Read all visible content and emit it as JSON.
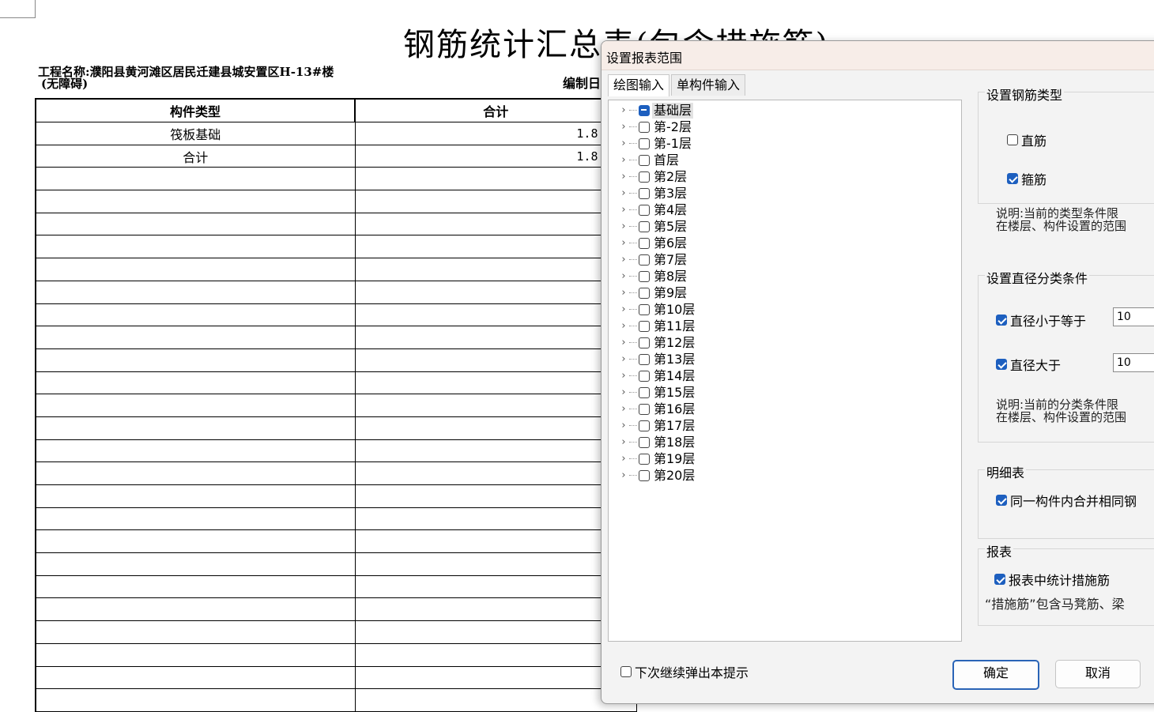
{
  "report": {
    "title": "钢筋统计汇总表(包含措施筋)",
    "project_label": "工程名称:濮阳县黄河滩区居民迁建县城安置区H-13#楼",
    "project_sub": "(无障碍)",
    "compiled_label": "编制日",
    "headers": [
      "构件类型",
      "合计"
    ],
    "rows": [
      {
        "type": "筏板基础",
        "total": "1.8"
      },
      {
        "type": "合计",
        "total": "1.8"
      }
    ]
  },
  "dialog": {
    "title": "设置报表范围",
    "tabs": [
      {
        "label": "绘图输入",
        "active": true
      },
      {
        "label": "单构件输入",
        "active": false
      }
    ],
    "floors": [
      {
        "label": "基础层",
        "state": "partial"
      },
      {
        "label": "第-2层",
        "state": "off"
      },
      {
        "label": "第-1层",
        "state": "off"
      },
      {
        "label": "首层",
        "state": "off"
      },
      {
        "label": "第2层",
        "state": "off"
      },
      {
        "label": "第3层",
        "state": "off"
      },
      {
        "label": "第4层",
        "state": "off"
      },
      {
        "label": "第5层",
        "state": "off"
      },
      {
        "label": "第6层",
        "state": "off"
      },
      {
        "label": "第7层",
        "state": "off"
      },
      {
        "label": "第8层",
        "state": "off"
      },
      {
        "label": "第9层",
        "state": "off"
      },
      {
        "label": "第10层",
        "state": "off"
      },
      {
        "label": "第11层",
        "state": "off"
      },
      {
        "label": "第12层",
        "state": "off"
      },
      {
        "label": "第13层",
        "state": "off"
      },
      {
        "label": "第14层",
        "state": "off"
      },
      {
        "label": "第15层",
        "state": "off"
      },
      {
        "label": "第16层",
        "state": "off"
      },
      {
        "label": "第17层",
        "state": "off"
      },
      {
        "label": "第18层",
        "state": "off"
      },
      {
        "label": "第19层",
        "state": "off"
      },
      {
        "label": "第20层",
        "state": "off"
      }
    ],
    "rebar_type": {
      "title": "设置钢筋类型",
      "straight": {
        "label": "直筋",
        "checked": false
      },
      "stirrup": {
        "label": "箍筋",
        "checked": true
      },
      "note_line1": "说明:当前的类型条件限",
      "note_line2": "在楼层、构件设置的范围"
    },
    "diameter": {
      "title": "设置直径分类条件",
      "le": {
        "label": "直径小于等于",
        "checked": true,
        "value": "10"
      },
      "gt": {
        "label": "直径大于",
        "checked": true,
        "value": "10"
      },
      "note_line1": "说明:当前的分类条件限",
      "note_line2": "在楼层、构件设置的范围"
    },
    "detail": {
      "title": "明细表",
      "merge": {
        "label": "同一构件内合并相同钢",
        "checked": true
      }
    },
    "report_opts": {
      "title": "报表",
      "count_measure": {
        "label": "报表中统计措施筋",
        "checked": true
      },
      "note": "“措施筋”包含马凳筋、梁"
    },
    "dont_show": {
      "label": "下次继续弹出本提示",
      "checked": false
    },
    "ok_label": "确定",
    "cancel_label": "取消"
  },
  "colors": {
    "accent": "#1d5fbf",
    "titlebar": "#f7ede8",
    "dialog_bg": "#f3f3f3"
  }
}
